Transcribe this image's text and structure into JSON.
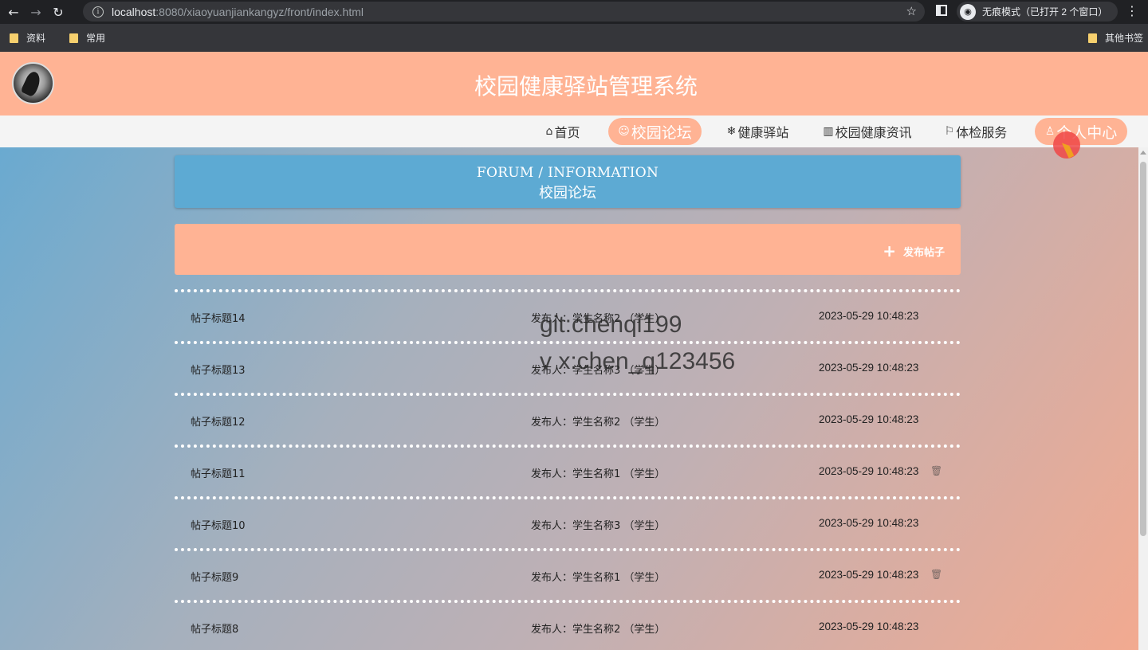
{
  "browser": {
    "url_host": "localhost",
    "url_rest": ":8080/xiaoyuanjiankangyz/front/index.html",
    "incognito_label": "无痕模式（已打开 2 个窗口）",
    "bookmarks": [
      "资料",
      "常用"
    ],
    "other_bookmarks": "其他书签"
  },
  "site": {
    "title": "校园健康驿站管理系统"
  },
  "nav": {
    "items": [
      {
        "icon": "⌂",
        "label": "首页"
      },
      {
        "icon": "☺",
        "label": "校园论坛"
      },
      {
        "icon": "❄",
        "label": "健康驿站"
      },
      {
        "icon": "▥",
        "label": "校园健康资讯"
      },
      {
        "icon": "⚐",
        "label": "体检服务"
      },
      {
        "icon": "♙",
        "label": "个人中心"
      }
    ],
    "active": "校园论坛"
  },
  "forum": {
    "banner_en": "FORUM / INFORMATION",
    "banner_cn": "校园论坛",
    "post_button": "发布帖子",
    "posts": [
      {
        "title": "帖子标题14",
        "author": "发布人：学生名称2 （学生）",
        "time": "2023-05-29 10:48:23",
        "deletable": false
      },
      {
        "title": "帖子标题13",
        "author": "发布人：学生名称3 （学生）",
        "time": "2023-05-29 10:48:23",
        "deletable": false
      },
      {
        "title": "帖子标题12",
        "author": "发布人：学生名称2 （学生）",
        "time": "2023-05-29 10:48:23",
        "deletable": false
      },
      {
        "title": "帖子标题11",
        "author": "发布人：学生名称1 （学生）",
        "time": "2023-05-29 10:48:23",
        "deletable": true
      },
      {
        "title": "帖子标题10",
        "author": "发布人：学生名称3 （学生）",
        "time": "2023-05-29 10:48:23",
        "deletable": false
      },
      {
        "title": "帖子标题9",
        "author": "发布人：学生名称1 （学生）",
        "time": "2023-05-29 10:48:23",
        "deletable": true
      },
      {
        "title": "帖子标题8",
        "author": "发布人：学生名称2 （学生）",
        "time": "2023-05-29 10:48:23",
        "deletable": false
      }
    ]
  },
  "watermark": {
    "line1": "git:chenqi199",
    "line2": "v x:chen_q123456"
  },
  "colors": {
    "header": "#ffb394",
    "banner": "#5daad3",
    "nav_bg": "#f4f4f4"
  }
}
